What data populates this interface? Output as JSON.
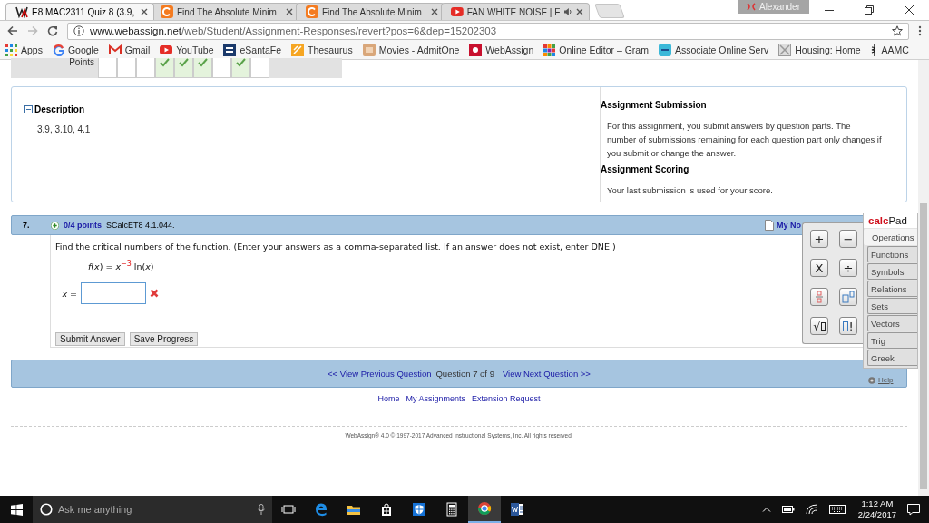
{
  "browser": {
    "tabs": [
      {
        "title": "E8 MAC2311 Quiz 8 (3.9,",
        "kind": "webassign",
        "selected": true,
        "audio": false
      },
      {
        "title": "Find The Absolute Minim",
        "kind": "chegg",
        "selected": false,
        "audio": false
      },
      {
        "title": "Find The Absolute Minim",
        "kind": "chegg",
        "selected": false,
        "audio": false
      },
      {
        "title": "FAN WHITE NOISE | F",
        "kind": "youtube",
        "selected": false,
        "audio": true
      }
    ],
    "profile": "Alexander",
    "url": {
      "domain": "www.webassign.net",
      "path": "/web/Student/Assignment-Responses/revert?pos=6&dep=15202303"
    },
    "bookmarks": [
      {
        "label": "Apps",
        "kind": "apps"
      },
      {
        "label": "Google",
        "kind": "google"
      },
      {
        "label": "Gmail",
        "kind": "gmail"
      },
      {
        "label": "YouTube",
        "kind": "youtube"
      },
      {
        "label": "eSantaFe",
        "kind": "esantafe"
      },
      {
        "label": "Thesaurus",
        "kind": "thesaurus"
      },
      {
        "label": "Movies - AdmitOne",
        "kind": "movies"
      },
      {
        "label": "WebAssign",
        "kind": "webassign"
      },
      {
        "label": "Online Editor – Gram",
        "kind": "editor"
      },
      {
        "label": "Associate Online Serv",
        "kind": "associate"
      },
      {
        "label": "Housing: Home",
        "kind": "housing"
      },
      {
        "label": "AAMC",
        "kind": "aamc"
      }
    ]
  },
  "page": {
    "points": {
      "label": "Points",
      "cells": [
        {
          "checked": false
        },
        {
          "checked": false
        },
        {
          "checked": false
        },
        {
          "checked": true
        },
        {
          "checked": true
        },
        {
          "checked": true
        },
        {
          "checked": false
        },
        {
          "checked": true
        },
        {
          "checked": false
        }
      ]
    },
    "description": {
      "title": "Description",
      "text": "3.9, 3.10, 4.1"
    },
    "submission": {
      "title": "Assignment Submission",
      "text": "For this assignment, you submit answers by question parts. The number of submissions remaining for each question part only changes if you submit or change the answer."
    },
    "scoring": {
      "title": "Assignment Scoring",
      "text": "Your last submission is used for your score."
    },
    "question": {
      "number": "7.",
      "points": "0/4 points",
      "source": "SCalcET8 4.1.044.",
      "notes": "My No",
      "prompt": "Find the critical numbers of the function. (Enter your answers as a comma-separated list. If an answer does not exist, enter DNE.)",
      "formula": "*f*(*x*) = *x*$^{−3}$ ln(*x*)",
      "answer": {
        "label": "*x* =",
        "correct": false
      },
      "buttons": [
        "Submit Answer",
        "Save Progress"
      ]
    },
    "nav": {
      "previous": "<< View Previous Question",
      "position": "Question 7 of 9",
      "next": "View Next Question >>"
    },
    "footer": {
      "links": [
        "Home",
        "My Assignments",
        "Extension Request"
      ],
      "copyright": "WebAssign® 4.0 © 1997-2017 Advanced Instructional Systems, Inc. All rights reserved."
    }
  },
  "calcpad": {
    "title": "calc",
    "title_suffix": "Pad",
    "keys": [
      {
        "kind": "symbol",
        "label": "+"
      },
      {
        "kind": "symbol",
        "label": "−"
      },
      {
        "kind": "symbol",
        "label": "X"
      },
      {
        "kind": "symbol",
        "label": "÷"
      },
      {
        "kind": "fraction"
      },
      {
        "kind": "power"
      },
      {
        "kind": "root",
        "label": "√"
      },
      {
        "kind": "factorial",
        "label": "!"
      }
    ],
    "categories": [
      {
        "label": "Operations",
        "selected": true
      },
      {
        "label": "Functions",
        "selected": false
      },
      {
        "label": "Symbols",
        "selected": false
      },
      {
        "label": "Relations",
        "selected": false
      },
      {
        "label": "Sets",
        "selected": false
      },
      {
        "label": "Vectors",
        "selected": false
      },
      {
        "label": "Trig",
        "selected": false
      },
      {
        "label": "Greek",
        "selected": false
      }
    ],
    "help": "Help"
  },
  "taskbar": {
    "search_placeholder": "Ask me anything",
    "apps": [
      {
        "kind": "taskview",
        "active": false
      },
      {
        "kind": "edge",
        "active": false
      },
      {
        "kind": "explorer",
        "active": false
      },
      {
        "kind": "store",
        "active": false
      },
      {
        "kind": "defender",
        "active": false
      },
      {
        "kind": "calculator",
        "active": false
      },
      {
        "kind": "chrome",
        "active": true
      },
      {
        "kind": "word",
        "active": false
      }
    ],
    "time": "1:12 AM",
    "date": "2/24/2017"
  }
}
